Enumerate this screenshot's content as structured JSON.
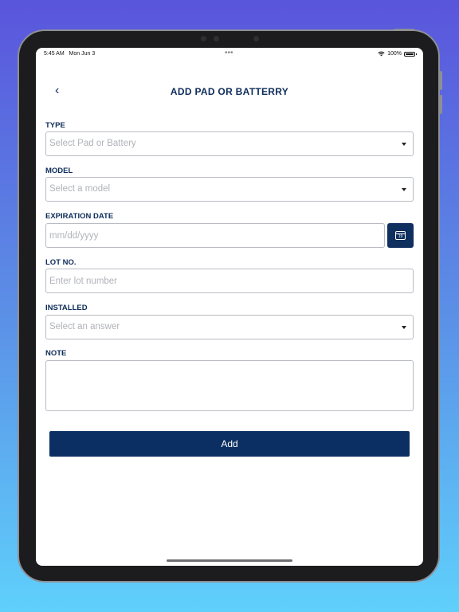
{
  "status_bar": {
    "time": "5:45 AM",
    "date": "Mon Jun 3",
    "dots": "•••",
    "battery_pct": "100%"
  },
  "header": {
    "back_icon": "‹",
    "title": "ADD PAD OR BATTERRY"
  },
  "form": {
    "type": {
      "label": "TYPE",
      "placeholder": "Select Pad or Battery"
    },
    "model": {
      "label": "MODEL",
      "placeholder": "Select a model"
    },
    "expiration": {
      "label": "EXPIRATION DATE",
      "placeholder": "mm/dd/yyyy",
      "calendar_day": "19"
    },
    "lot": {
      "label": "LOT NO.",
      "placeholder": "Enter lot number"
    },
    "installed": {
      "label": "INSTALLED",
      "placeholder": "Select an answer"
    },
    "note": {
      "label": "NOTE",
      "placeholder": ""
    },
    "submit_label": "Add"
  },
  "colors": {
    "primary": "#0b2f62",
    "label": "#0d2c5a",
    "placeholder": "#b0b3b8",
    "border": "#b9bcc2"
  }
}
